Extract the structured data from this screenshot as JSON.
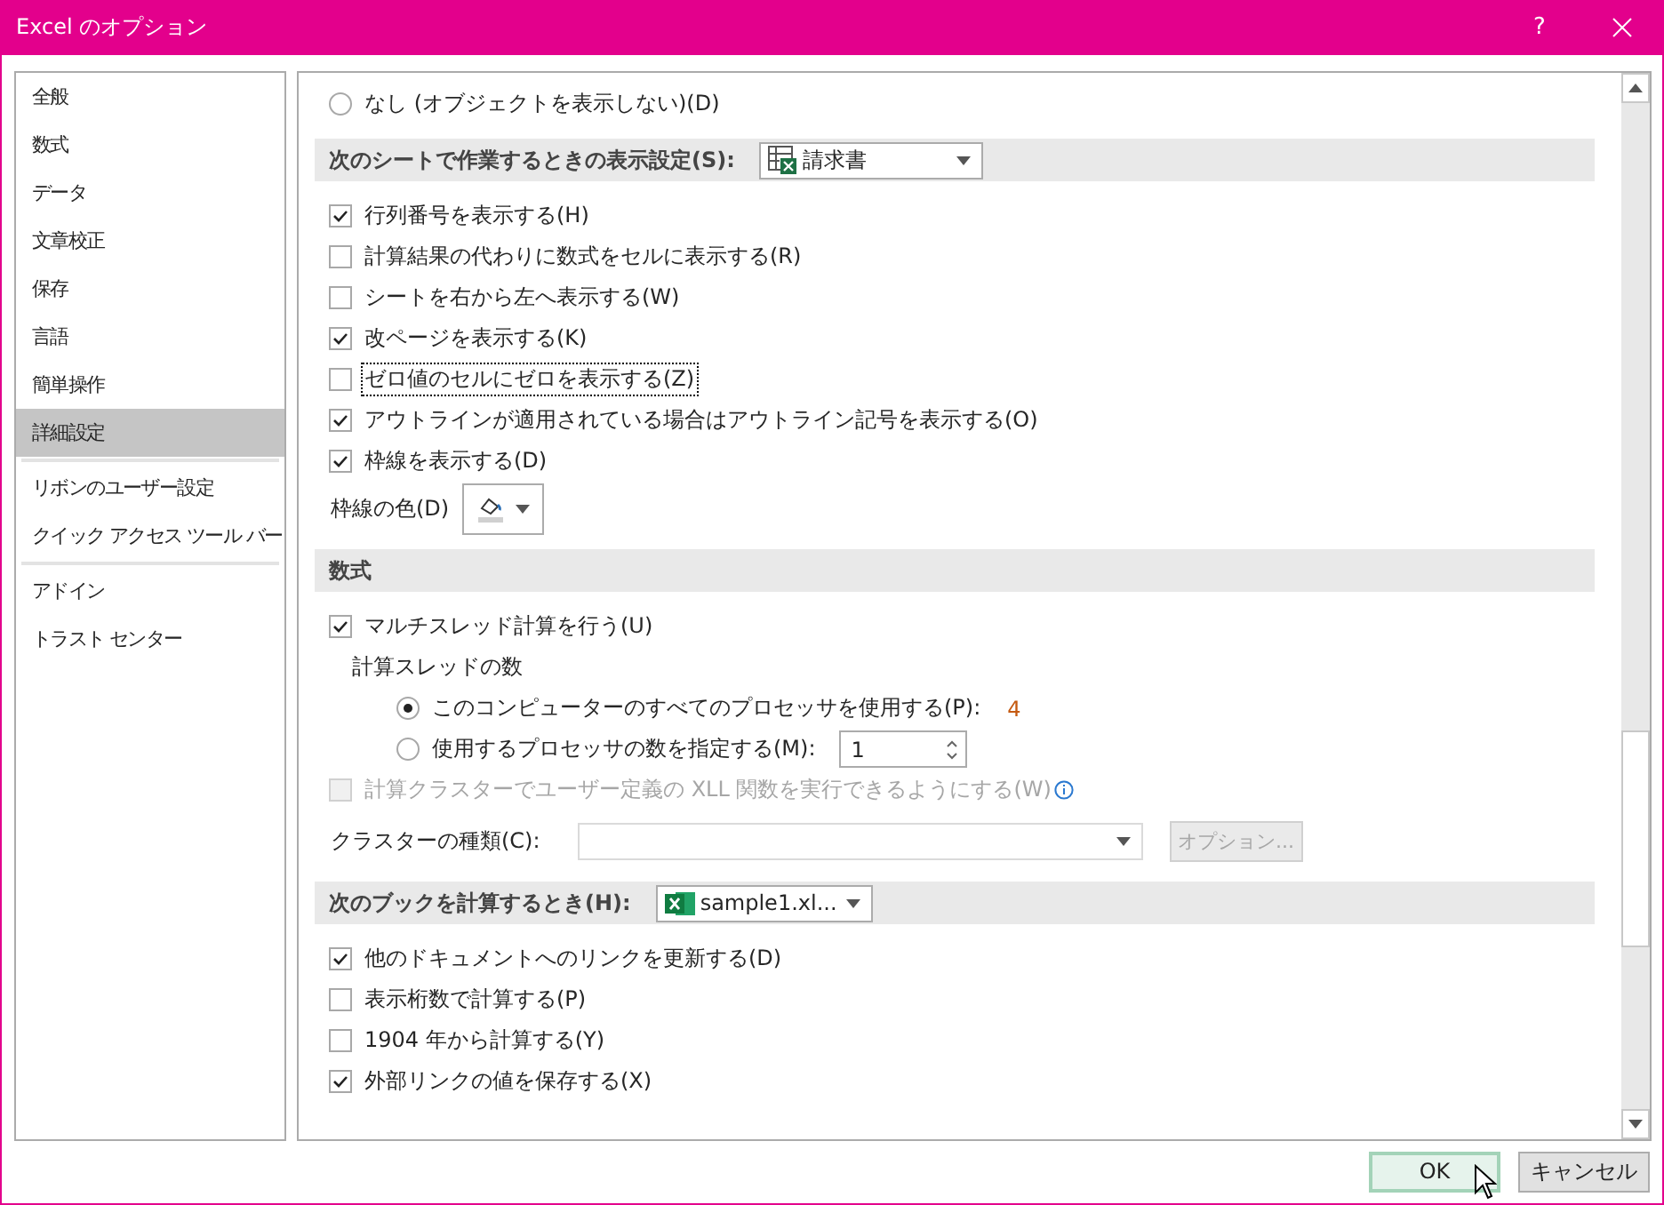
{
  "window": {
    "title": "Excel のオプション",
    "help": "?"
  },
  "sidebar": {
    "groups": [
      {
        "items": [
          {
            "label": "全般",
            "selected": false
          },
          {
            "label": "数式",
            "selected": false
          },
          {
            "label": "データ",
            "selected": false
          },
          {
            "label": "文章校正",
            "selected": false
          },
          {
            "label": "保存",
            "selected": false
          },
          {
            "label": "言語",
            "selected": false
          },
          {
            "label": "簡単操作",
            "selected": false
          },
          {
            "label": "詳細設定",
            "selected": true
          }
        ]
      },
      {
        "items": [
          {
            "label": "リボンのユーザー設定",
            "selected": false
          },
          {
            "label": "クイック アクセス ツール バー",
            "selected": false
          }
        ]
      },
      {
        "items": [
          {
            "label": "アドイン",
            "selected": false
          },
          {
            "label": "トラスト センター",
            "selected": false
          }
        ]
      }
    ]
  },
  "content": [
    {
      "kind": "radio",
      "label": "なし (オブジェクトを表示しない)(D)",
      "selected": false
    },
    {
      "kind": "header",
      "label": "次のシートで作業するときの表示設定(S):",
      "dropdown": {
        "value": "請求書",
        "kind": "sheet"
      }
    },
    {
      "kind": "checkbox",
      "label": "行列番号を表示する(H)",
      "checked": true,
      "disabled": false,
      "focused": false
    },
    {
      "kind": "checkbox",
      "label": "計算結果の代わりに数式をセルに表示する(R)",
      "checked": false,
      "disabled": false,
      "focused": false
    },
    {
      "kind": "checkbox",
      "label": "シートを右から左へ表示する(W)",
      "checked": false,
      "disabled": false,
      "focused": false
    },
    {
      "kind": "checkbox",
      "label": "改ページを表示する(K)",
      "checked": true,
      "disabled": false,
      "focused": false
    },
    {
      "kind": "checkbox",
      "label": "ゼロ値のセルにゼロを表示する(Z)",
      "checked": false,
      "disabled": false,
      "focused": true
    },
    {
      "kind": "checkbox",
      "label": "アウトラインが適用されている場合はアウトライン記号を表示する(O)",
      "checked": true,
      "disabled": false,
      "focused": false
    },
    {
      "kind": "checkbox",
      "label": "枠線を表示する(D)",
      "checked": true,
      "disabled": false,
      "focused": false
    },
    {
      "kind": "color",
      "label": "枠線の色(D)"
    },
    {
      "kind": "header",
      "label": "数式"
    },
    {
      "kind": "checkbox",
      "label": "マルチスレッド計算を行う(U)",
      "checked": true,
      "disabled": false,
      "focused": false
    },
    {
      "kind": "group",
      "label": "計算スレッドの数",
      "children": [
        {
          "kind": "radio",
          "label": "このコンピューターのすべてのプロセッサを使用する(P):",
          "selected": true,
          "value": "4"
        },
        {
          "kind": "radio",
          "label": "使用するプロセッサの数を指定する(M):",
          "selected": false,
          "spinner": "1"
        }
      ]
    },
    {
      "kind": "checkbox",
      "label": "計算クラスターでユーザー定義の XLL 関数を実行できるようにする(W)",
      "checked": false,
      "disabled": true,
      "focused": false,
      "info": true
    },
    {
      "kind": "select",
      "label": "クラスターの種類(C):",
      "button": "オプション..."
    },
    {
      "kind": "header",
      "label": "次のブックを計算するとき(H):",
      "dropdown": {
        "value": "sample1.xl...",
        "kind": "workbook"
      }
    },
    {
      "kind": "checkbox",
      "label": "他のドキュメントへのリンクを更新する(D)",
      "checked": true,
      "disabled": false,
      "focused": false
    },
    {
      "kind": "checkbox",
      "label": "表示桁数で計算する(P)",
      "checked": false,
      "disabled": false,
      "focused": false
    },
    {
      "kind": "checkbox",
      "label": "1904 年から計算する(Y)",
      "checked": false,
      "disabled": false,
      "focused": false
    },
    {
      "kind": "checkbox",
      "label": "外部リンクの値を保存する(X)",
      "checked": true,
      "disabled": false,
      "focused": false
    }
  ],
  "buttons": [
    {
      "label": "OK",
      "default": true
    },
    {
      "label": "キャンセル",
      "default": false
    }
  ]
}
